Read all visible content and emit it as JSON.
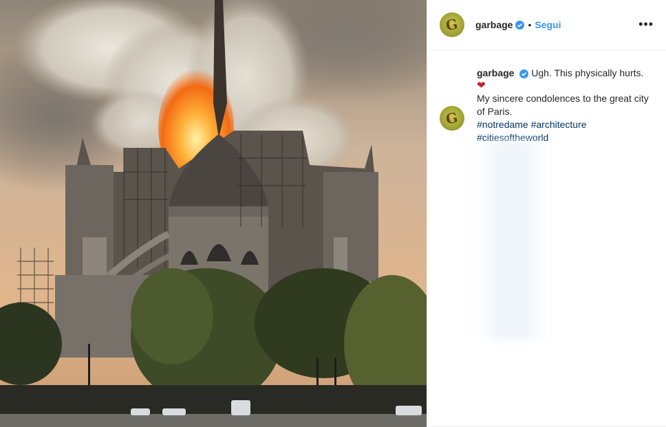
{
  "post": {
    "image": {
      "alt": "",
      "colors": {
        "sky": "#c9a988",
        "smoke": "#d8d3c9",
        "fire": "#ff7a1a",
        "stone": "#6f6a63",
        "trees": "#3e4a26"
      }
    },
    "header": {
      "avatar_letter": "G",
      "username": "garbage",
      "verified_icon": "verified-badge-icon",
      "separator": "•",
      "follow_label": "Segui",
      "more_label": "•••"
    },
    "caption": {
      "avatar_letter": "G",
      "username": "garbage",
      "line1": "Ugh. This physically hurts.",
      "emoji": "❤",
      "line2": "My sincere condolences to the great city of Paris.",
      "hashtags": [
        "#notredame",
        "#architecture",
        "#citiesoftheworld"
      ]
    },
    "accent_color": "#3897f0",
    "hashtag_color": "#003569"
  }
}
